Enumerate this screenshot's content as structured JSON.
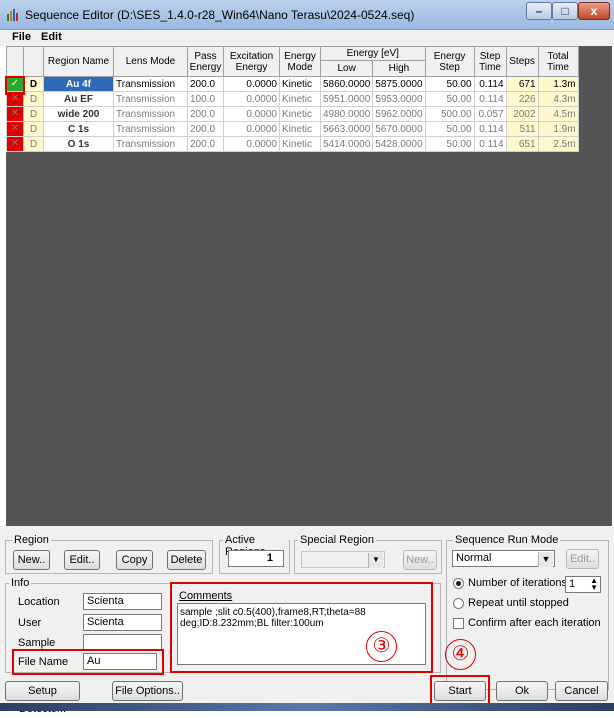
{
  "window": {
    "title": "Sequence Editor (D:\\SES_1.4.0-r28_Win64\\Nano Terasu\\2024-0524.seq)",
    "minimize": "–",
    "maximize": "□",
    "close": "x"
  },
  "menu": {
    "file": "File",
    "edit": "Edit"
  },
  "table": {
    "headers": {
      "region_name": "Region Name",
      "lens_mode": "Lens Mode",
      "pass_energy": "Pass Energy",
      "excitation_energy": "Excitation Energy",
      "energy_mode": "Energy Mode",
      "energy_ev": "Energy [eV]",
      "low": "Low",
      "high": "High",
      "energy_step": "Energy Step",
      "step_time": "Step Time",
      "steps": "Steps",
      "total_time": "Total Time"
    },
    "rows": [
      {
        "status": "✓",
        "d": "D",
        "name": "Au 4f",
        "lens": "Transmission",
        "pass": "200.0",
        "exc": "0.0000",
        "mode": "Kinetic",
        "low": "5860.0000",
        "high": "5875.0000",
        "estep": "50.00",
        "stime": "0.114",
        "steps": "671",
        "total": "1.3m"
      },
      {
        "status": "✕",
        "d": "D",
        "name": "Au EF",
        "lens": "Transmission",
        "pass": "100.0",
        "exc": "0.0000",
        "mode": "Kinetic",
        "low": "5951.0000",
        "high": "5953.0000",
        "estep": "50.00",
        "stime": "0.114",
        "steps": "226",
        "total": "4.3m"
      },
      {
        "status": "✕",
        "d": "D",
        "name": "wide 200",
        "lens": "Transmission",
        "pass": "200.0",
        "exc": "0.0000",
        "mode": "Kinetic",
        "low": "4980.0000",
        "high": "5962.0000",
        "estep": "500.00",
        "stime": "0.057",
        "steps": "2002",
        "total": "4.5m"
      },
      {
        "status": "✕",
        "d": "D",
        "name": "C 1s",
        "lens": "Transmission",
        "pass": "200.0",
        "exc": "0.0000",
        "mode": "Kinetic",
        "low": "5663.0000",
        "high": "5670.0000",
        "estep": "50.00",
        "stime": "0.114",
        "steps": "511",
        "total": "1.9m"
      },
      {
        "status": "✕",
        "d": "D",
        "name": "O 1s",
        "lens": "Transmission",
        "pass": "200.0",
        "exc": "0.0000",
        "mode": "Kinetic",
        "low": "5414.0000",
        "high": "5428.0000",
        "estep": "50.00",
        "stime": "0.114",
        "steps": "651",
        "total": "2.5m"
      }
    ]
  },
  "region": {
    "label": "Region",
    "new": "New..",
    "edit": "Edit..",
    "copy": "Copy",
    "delete": "Delete"
  },
  "active_regions": {
    "label": "Active Regions",
    "value": "1"
  },
  "special_region": {
    "label": "Special Region",
    "new": "New.."
  },
  "sequence_run_mode": {
    "label": "Sequence Run Mode",
    "value": "Normal",
    "edit": "Edit..",
    "number_of_iterations": "Number of iterations",
    "iterations_value": "1",
    "repeat_until_stopped": "Repeat until stopped",
    "confirm_after_each_iteration": "Confirm after each iteration"
  },
  "info": {
    "label": "Info",
    "location_label": "Location",
    "location": "Scienta",
    "user_label": "User",
    "user": "Scienta",
    "sample_label": "Sample",
    "sample": "",
    "file_name_label": "File Name",
    "file_name": "Au"
  },
  "comments": {
    "label": "Comments",
    "text": "sample ;slit c0.5(400),frame8,RT;theta=88 deg;ID:8.232mm;BL filter:100um"
  },
  "annotations": {
    "three": "③",
    "four": "④"
  },
  "buttons": {
    "setup_detector": "Setup Detector..",
    "file_options": "File Options..",
    "start": "Start",
    "ok": "Ok",
    "cancel": "Cancel"
  }
}
